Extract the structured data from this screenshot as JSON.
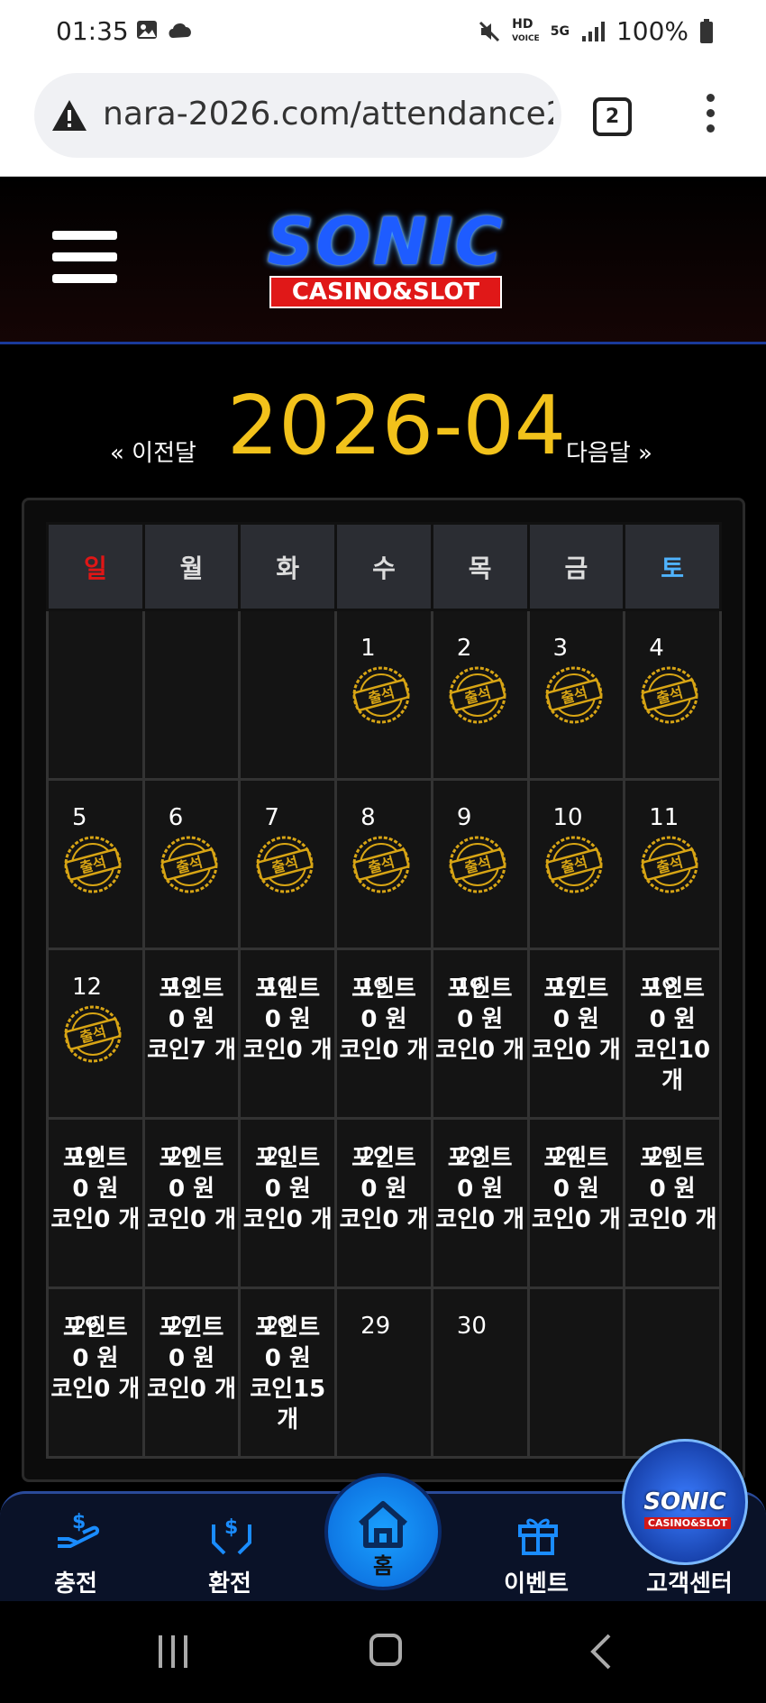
{
  "status": {
    "time": "01:35",
    "battery": "100%",
    "network": "5G"
  },
  "browser": {
    "url": "nara-2026.com/attendance2",
    "tab_count": "2"
  },
  "logo": {
    "main": "SONIC",
    "sub": "CASINO&SLOT"
  },
  "month_nav": {
    "prev": "« 이전달",
    "title": "2026-04",
    "next": "다음달 »"
  },
  "weekdays": [
    "일",
    "월",
    "화",
    "수",
    "목",
    "금",
    "토"
  ],
  "stamp_label": "출석",
  "labels": {
    "point": "포인트",
    "won": "원",
    "coin": "코인",
    "unit": "개"
  },
  "calendar": [
    [
      null,
      null,
      null,
      {
        "day": "1",
        "attended": true
      },
      {
        "day": "2",
        "attended": true
      },
      {
        "day": "3",
        "attended": true
      },
      {
        "day": "4",
        "attended": true
      }
    ],
    [
      {
        "day": "5",
        "attended": true
      },
      {
        "day": "6",
        "attended": true
      },
      {
        "day": "7",
        "attended": true
      },
      {
        "day": "8",
        "attended": true
      },
      {
        "day": "9",
        "attended": true
      },
      {
        "day": "10",
        "attended": true
      },
      {
        "day": "11",
        "attended": true
      }
    ],
    [
      {
        "day": "12",
        "attended": true
      },
      {
        "day": "13",
        "point": "0",
        "coin": "7"
      },
      {
        "day": "14",
        "point": "0",
        "coin": "0"
      },
      {
        "day": "15",
        "point": "0",
        "coin": "0"
      },
      {
        "day": "16",
        "point": "0",
        "coin": "0"
      },
      {
        "day": "17",
        "point": "0",
        "coin": "0"
      },
      {
        "day": "18",
        "point": "0",
        "coin": "10"
      }
    ],
    [
      {
        "day": "19",
        "point": "0",
        "coin": "0"
      },
      {
        "day": "20",
        "point": "0",
        "coin": "0"
      },
      {
        "day": "21",
        "point": "0",
        "coin": "0"
      },
      {
        "day": "22",
        "point": "0",
        "coin": "0"
      },
      {
        "day": "23",
        "point": "0",
        "coin": "0"
      },
      {
        "day": "24",
        "point": "0",
        "coin": "0"
      },
      {
        "day": "25",
        "point": "0",
        "coin": "0"
      }
    ],
    [
      {
        "day": "26",
        "point": "0",
        "coin": "0"
      },
      {
        "day": "27",
        "point": "0",
        "coin": "0"
      },
      {
        "day": "28",
        "point": "0",
        "coin": "15"
      },
      {
        "day": "29"
      },
      {
        "day": "30"
      },
      null,
      null
    ]
  ],
  "bottom_nav": {
    "charge": "충전",
    "exchange": "환전",
    "home": "홈",
    "event": "이벤트",
    "support": "고객센터"
  },
  "colors": {
    "title": "#f2c21b",
    "sunday": "#e01616",
    "saturday": "#4fb3ff",
    "accent": "#1a8cff"
  }
}
